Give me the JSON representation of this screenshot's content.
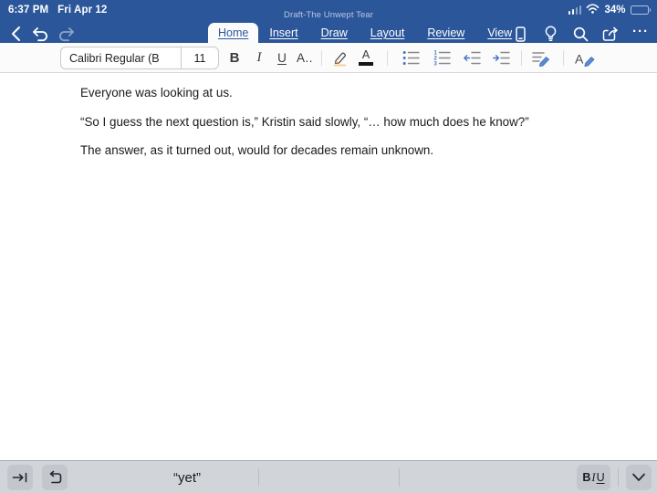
{
  "colors": {
    "word_blue": "#2b579a",
    "icon_accent_blue": "#4472c4",
    "highlighter_orange": "#f2a33c",
    "keyboard_bar_gray": "#d1d4d9"
  },
  "status_bar": {
    "time": "6:37 PM",
    "date": "Fri Apr 12",
    "battery_percent": "34%"
  },
  "nav": {
    "document_title": "Draft-The Unwept Tear",
    "tabs": [
      {
        "label": "Home",
        "active": true
      },
      {
        "label": "Insert",
        "active": false
      },
      {
        "label": "Draw",
        "active": false
      },
      {
        "label": "Layout",
        "active": false
      },
      {
        "label": "Review",
        "active": false
      },
      {
        "label": "View",
        "active": false
      }
    ],
    "more_icon_glyph": "···"
  },
  "toolbar": {
    "font_name": "Calibri Regular (B",
    "font_size": "11",
    "bold_label": "B",
    "italic_label": "I",
    "underline_label": "U",
    "more_font_formatting_label": "A..",
    "font_color_label": "A"
  },
  "document": {
    "paragraphs": [
      "Everyone was looking at us.",
      "“So I guess the next question is,” Kristin said slowly, “… how much does he know?”",
      "The answer, as it turned out, would for decades remain unknown."
    ]
  },
  "keyboard_bar": {
    "suggestion": "“yet”",
    "bold_label": "B",
    "italic_label": "I",
    "underline_label": "U"
  }
}
